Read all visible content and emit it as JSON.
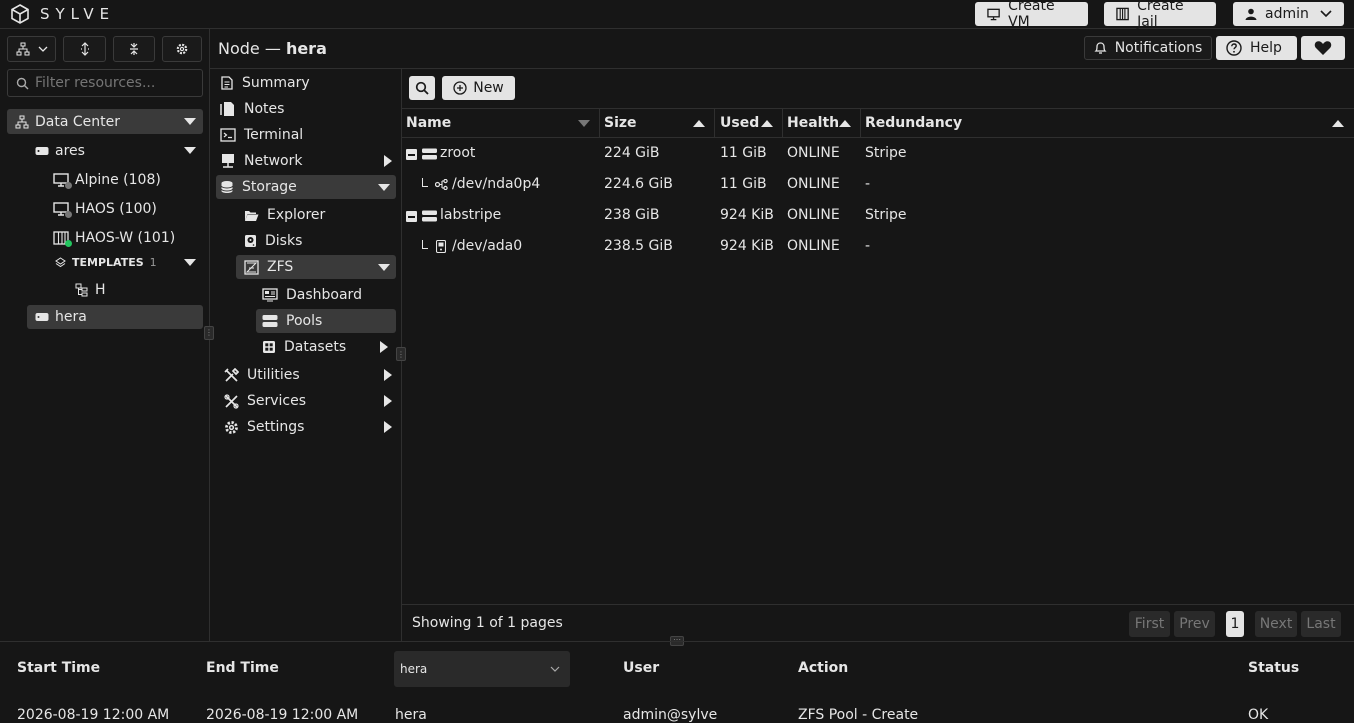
{
  "app": {
    "name": "SYLVE"
  },
  "topbar": {
    "create_vm": "Create VM",
    "create_jail": "Create Jail",
    "user": "admin"
  },
  "header": {
    "prefix": "Node —",
    "node": "hera",
    "notifications": "Notifications",
    "help": "Help"
  },
  "sidebar": {
    "filter_placeholder": "Filter resources...",
    "tree": {
      "datacenter": "Data Center",
      "node1": "ares",
      "vm1": "Alpine (108)",
      "vm2": "HAOS (100)",
      "jail1": "HAOS-W (101)",
      "templates": "TEMPLATES",
      "templates_count": "1",
      "template1": "H",
      "node2": "hera"
    }
  },
  "menu": {
    "summary": "Summary",
    "notes": "Notes",
    "terminal": "Terminal",
    "network": "Network",
    "storage": "Storage",
    "explorer": "Explorer",
    "disks": "Disks",
    "zfs": "ZFS",
    "dashboard": "Dashboard",
    "pools": "Pools",
    "datasets": "Datasets",
    "utilities": "Utilities",
    "services": "Services",
    "settings": "Settings"
  },
  "pools": {
    "new_label": "New",
    "columns": [
      "Name",
      "Size",
      "Used",
      "Health",
      "Redundancy"
    ],
    "rows": [
      {
        "name": "zroot",
        "size": "224 GiB",
        "used": "11 GiB",
        "health": "ONLINE",
        "redundancy": "Stripe"
      },
      {
        "name": "/dev/nda0p4",
        "size": "224.6 GiB",
        "used": "11 GiB",
        "health": "ONLINE",
        "redundancy": "-"
      },
      {
        "name": "labstripe",
        "size": "238 GiB",
        "used": "924 KiB",
        "health": "ONLINE",
        "redundancy": "Stripe"
      },
      {
        "name": "/dev/ada0",
        "size": "238.5 GiB",
        "used": "924 KiB",
        "health": "ONLINE",
        "redundancy": "-"
      }
    ],
    "footer": "Showing 1 of 1 pages",
    "pager": {
      "first": "First",
      "prev": "Prev",
      "page": "1",
      "next": "Next",
      "last": "Last"
    }
  },
  "tasks": {
    "columns": {
      "start": "Start Time",
      "end": "End Time",
      "node_filter": "hera",
      "user": "User",
      "action": "Action",
      "status": "Status"
    },
    "rows": [
      {
        "start": "2026-08-19 12:00 AM",
        "end": "2026-08-19 12:00 AM",
        "node": "hera",
        "user": "admin@sylve",
        "action": "ZFS Pool - Create",
        "status": "OK"
      }
    ]
  },
  "colors": {
    "bg": "#161616",
    "selected": "#3a3a3a",
    "online_dot": "#22c55e",
    "offline_dot": "#777777"
  }
}
